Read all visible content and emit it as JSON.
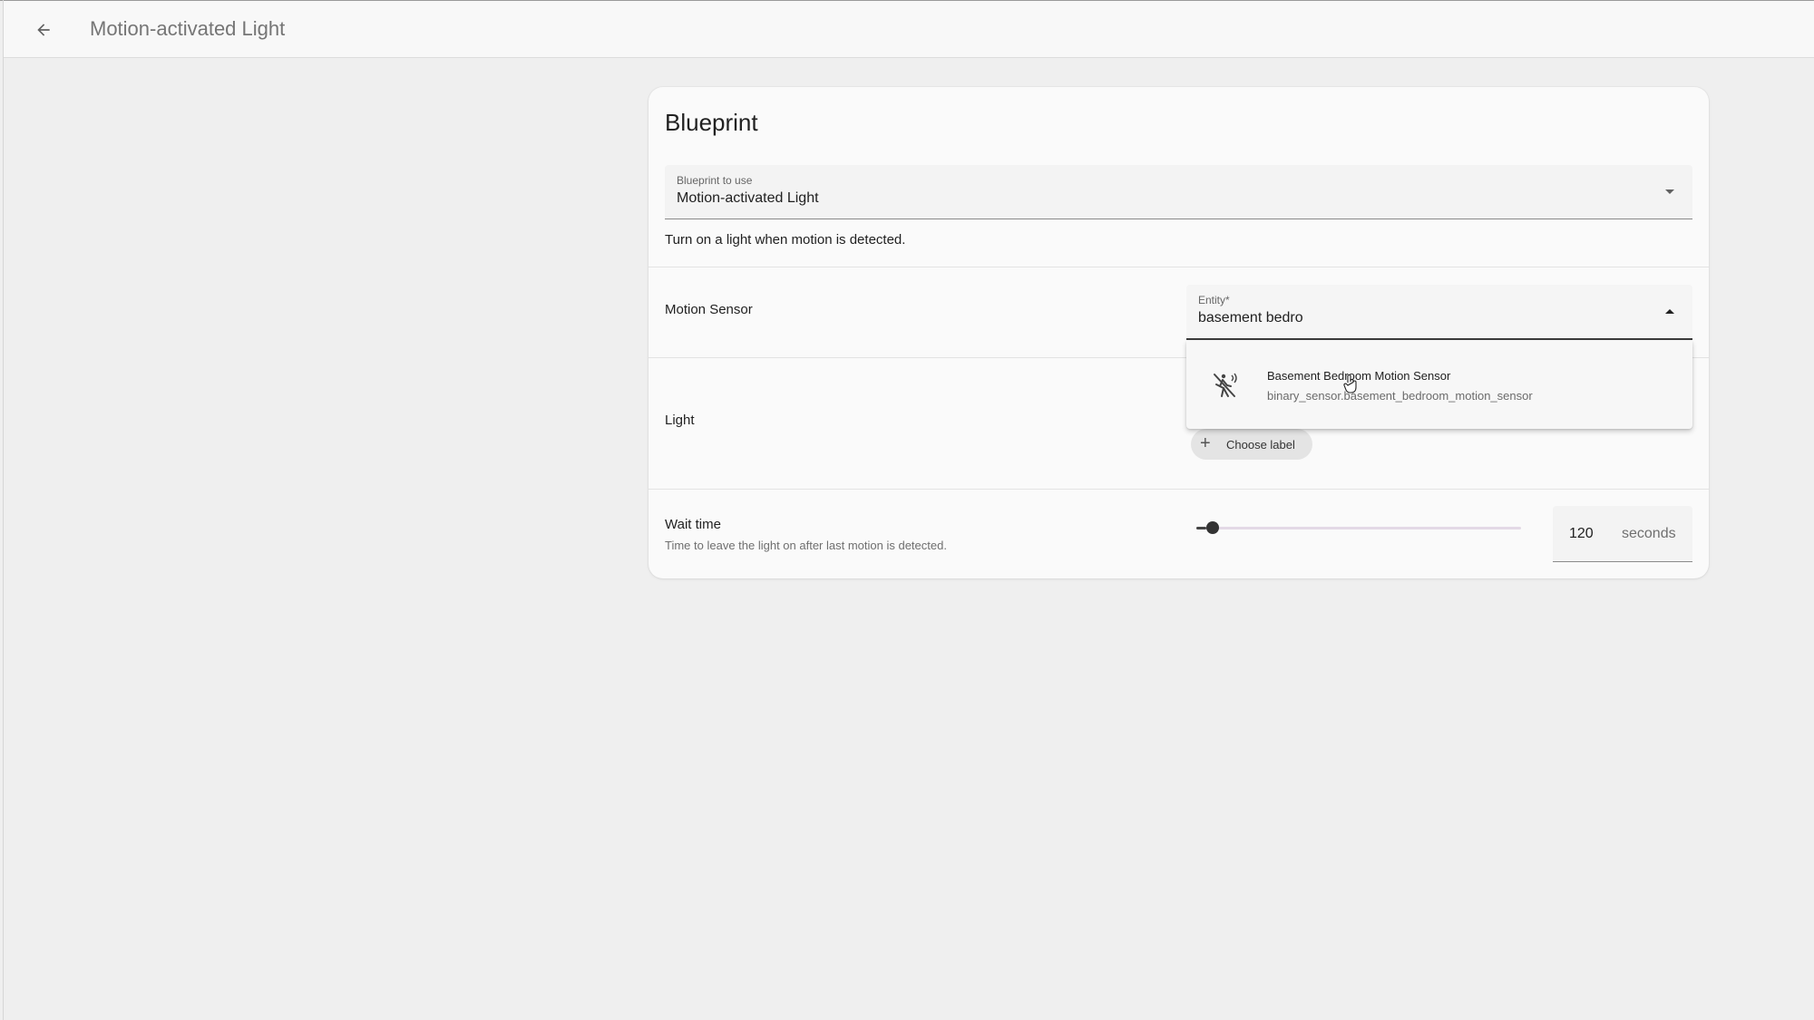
{
  "header": {
    "back_icon": "arrow-left-icon",
    "title": "Motion-activated Light"
  },
  "card": {
    "title": "Blueprint",
    "blueprint_select": {
      "label": "Blueprint to use",
      "value": "Motion-activated Light"
    },
    "description": "Turn on a light when motion is detected.",
    "motion_sensor": {
      "label": "Motion Sensor",
      "entity_field": {
        "label": "Entity*",
        "value": "basement bedro"
      },
      "suggestions": [
        {
          "icon": "motion-sensor-off-icon",
          "name": "Basement Bedroom Motion Sensor",
          "entity_id": "binary_sensor.basement_bedroom_motion_sensor"
        }
      ]
    },
    "light": {
      "label": "Light",
      "choose_label_button": "Choose label"
    },
    "wait_time": {
      "label": "Wait time",
      "description": "Time to leave the light on after last motion is detected.",
      "value": "120",
      "unit": "seconds",
      "slider_fraction": 0.03
    }
  }
}
